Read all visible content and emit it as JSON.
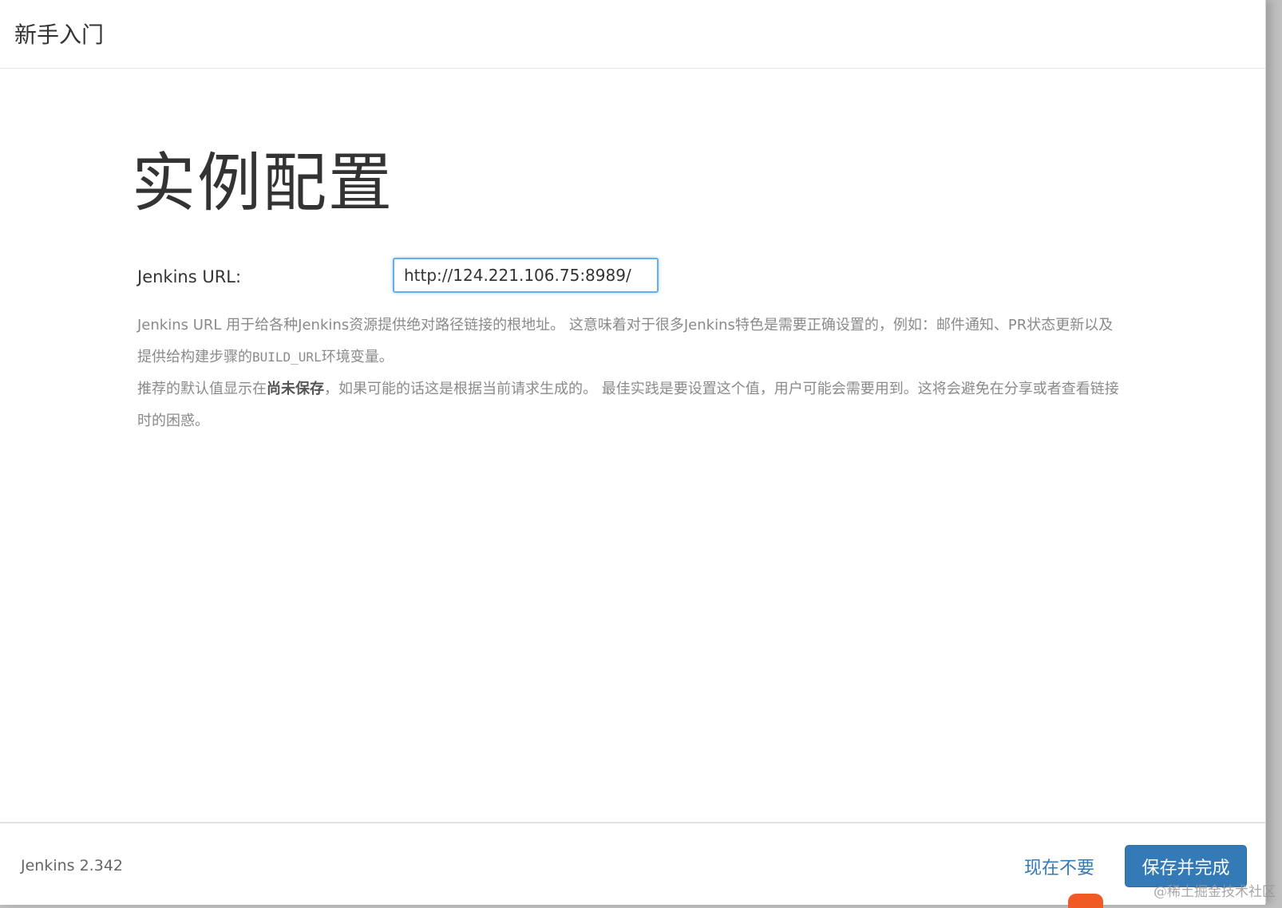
{
  "header": {
    "title": "新手入门"
  },
  "main": {
    "heading": "实例配置",
    "url_label": "Jenkins URL:",
    "url_value": "http://124.221.106.75:8989/",
    "help_1_a": "Jenkins URL 用于给各种Jenkins资源提供绝对路径链接的根地址。 这意味着对于很多Jenkins特色是需要正确设置的，例如：邮件通知、PR状态更新以及提供给构建步骤的",
    "help_1_code": "BUILD_URL",
    "help_1_b": "环境变量。",
    "help_2_a": "推荐的默认值显示在",
    "help_2_bold": "尚未保存",
    "help_2_b": "，如果可能的话这是根据当前请求生成的。 最佳实践是要设置这个值，用户可能会需要用到。这将会避免在分享或者查看链接时的困惑。"
  },
  "footer": {
    "version": "Jenkins 2.342",
    "skip_label": "现在不要",
    "save_label": "保存并完成"
  },
  "watermark": "@稀土掘金技术社区",
  "colors": {
    "accent": "#337ab7",
    "input_focus": "#66afe9",
    "text": "#333333",
    "muted": "#8a8a8a"
  }
}
